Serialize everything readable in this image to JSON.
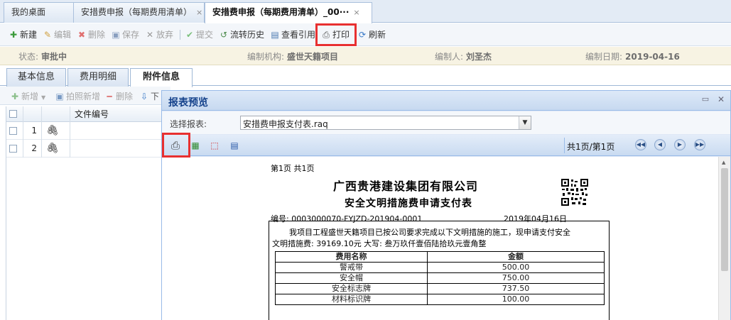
{
  "tabs": [
    {
      "label": "我的桌面"
    },
    {
      "label": "安措费申报（每期费用清单）"
    },
    {
      "label": "安措费申报（每期费用清单）_00···"
    }
  ],
  "tab_close": "×",
  "toolbar": {
    "new": "新建",
    "edit": "编辑",
    "delete": "删除",
    "save": "保存",
    "discard": "放弃",
    "submit": "提交",
    "history": "流转历史",
    "view_ref": "查看引用",
    "print": "打印",
    "refresh": "刷新"
  },
  "info": {
    "status_label": "状态:",
    "status_value": "审批中",
    "org_label": "编制机构:",
    "org_value": "盛世天籍项目",
    "author_label": "编制人:",
    "author_value": "刘圣杰",
    "date_label": "编制日期:",
    "date_value": "2019-04-16"
  },
  "subtabs": [
    "基本信息",
    "费用明细",
    "附件信息"
  ],
  "attach_toolbar": {
    "add": "新增",
    "photo_add": "拍照新增",
    "delete": "删除",
    "download": "下"
  },
  "grid": {
    "col_file_no": "文件编号",
    "rows": [
      {
        "num": "1"
      },
      {
        "num": "2"
      }
    ]
  },
  "modal": {
    "title": "报表预览",
    "select_label": "选择报表:",
    "select_value": "安措费申报支付表.raq",
    "page_info": "共1页/第1页"
  },
  "report": {
    "page_header": "第1页  共1页",
    "company": "广西贵港建设集团有限公司",
    "form_title": "安全文明措施费申请支付表",
    "number": "编号: 0003000070-FYJZD-201904-0001",
    "date": "2019年04月16日",
    "body_line1": "我项目工程盛世天籍项目已按公司要求完成以下文明措施的施工，现申请支付安全",
    "body_line2": "文明措施费: 39169.10元   大写: 叁万玖仟壹佰陆拾玖元壹角整",
    "table_headers": [
      "费用名称",
      "金额"
    ],
    "table_rows": [
      {
        "name": "警戒带",
        "amount": "500.00"
      },
      {
        "name": "安全帽",
        "amount": "750.00"
      },
      {
        "name": "安全标志牌",
        "amount": "737.50"
      },
      {
        "name": "材料标识牌",
        "amount": "100.00"
      }
    ]
  },
  "colors": {
    "highlight": "#e83030",
    "header_blue": "#15428b"
  }
}
